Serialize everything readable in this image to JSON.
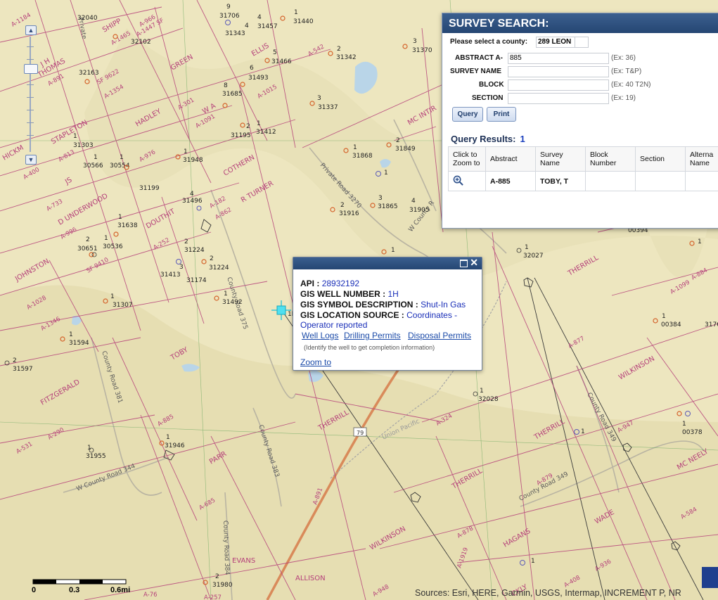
{
  "survey_panel": {
    "title": "SURVEY SEARCH:",
    "county_label": "Please select a county:",
    "county_value": "289 LEON",
    "fields": [
      {
        "label": "ABSTRACT A-",
        "value": "885",
        "example": "(Ex: 36)"
      },
      {
        "label": "SURVEY NAME",
        "value": "",
        "example": "(Ex: T&P)"
      },
      {
        "label": "BLOCK",
        "value": "",
        "example": "(Ex: 40 T2N)"
      },
      {
        "label": "SECTION",
        "value": "",
        "example": "(Ex: 19)"
      }
    ],
    "query_button": "Query",
    "print_button": "Print",
    "results_label": "Query Results:",
    "results_count": "1",
    "columns": [
      "Click to Zoom to",
      "Abstract",
      "Survey Name",
      "Block Number",
      "Section",
      "Alterna Name"
    ],
    "rows": [
      {
        "abstract": "A-885",
        "survey_name": "TOBY, T",
        "block": "",
        "section": "",
        "alt": ""
      }
    ]
  },
  "popup": {
    "api_label": "API :",
    "api_value": "28932192",
    "well_number_label": "GIS WELL NUMBER :",
    "well_number_value": "1H",
    "symbol_label": "GIS SYMBOL DESCRIPTION :",
    "symbol_value": "Shut-In Gas",
    "location_label": "GIS LOCATION SOURCE :",
    "location_value_1": "Coordinates -",
    "location_value_2": "Operator reported",
    "link_well_logs": "Well Logs",
    "link_drilling": "Drilling Permits",
    "link_disposal": "Disposal Permits",
    "note": "(Identify the well to get completion information)",
    "zoom_to": "Zoom to"
  },
  "scale": {
    "labels": [
      "0",
      "0.3",
      "0.6mi"
    ]
  },
  "attribution": "Sources: Esri, HERE, Garmin, USGS, Intermap, INCREMENT P, NR",
  "map_labels": {
    "surveys": [
      "J H THOMAS",
      "A STAPLETON",
      "HADLEY",
      "E GREEN",
      "W A",
      "JS",
      "D UNDERWOOD",
      "W DOUTHIT",
      "R TURNER",
      "A COTHERN",
      "JB JOHNSTON",
      "T TOBY",
      "J FITZGERALD",
      "J FITZGERALD",
      "S PARR",
      "W EVANS",
      "J ALLISON",
      "W H WILKINSON",
      "JB & JE THERRILL",
      "JB & JE THERRILL",
      "JB & JE THERRILL",
      "JB & JE THERRILL",
      "M HAGANS",
      "R WADE",
      "W H WILKINSON",
      "H MC NEELY",
      "W MC INTIR",
      "SHIPP",
      "HICKM",
      "ELLIS",
      "CKLY"
    ],
    "abstracts": [
      "A-1184",
      "A-966",
      "A-1447 SF",
      "A-1465",
      "A-891",
      "SF 9622",
      "A-1354",
      "A-301",
      "A-1091",
      "A-813",
      "A-976",
      "A-400",
      "A-733",
      "A-996",
      "A-252",
      "SF 9410",
      "A-182",
      "A-862",
      "A-1028",
      "A-1346",
      "A-542",
      "A-1015",
      "A-885",
      "A-290",
      "A-531",
      "A-685",
      "A-324",
      "A-877",
      "A-947",
      "A-879",
      "A-584",
      "A-878",
      "A-1919",
      "A-936",
      "A-408",
      "A-948",
      "A-76",
      "A-257",
      "A-1099",
      "A-884",
      "A-891"
    ],
    "roads": [
      "Private Road 3270",
      "County Road 375",
      "County Road 381",
      "County Road 383",
      "County Road 384",
      "County Road 349",
      "County Road 349",
      "W County Road 344",
      "W County R",
      "Union Pacific",
      "79",
      "Private"
    ],
    "wells": [
      "32040",
      "32102",
      "32163",
      "31706",
      "31343",
      "31457",
      "31440",
      "31466",
      "31493",
      "31685",
      "31337",
      "31342",
      "31370",
      "31195",
      "31412",
      "31303",
      "31948",
      "30566",
      "30554",
      "31199",
      "31496",
      "31868",
      "31849",
      "31865",
      "31905",
      "31916",
      "31638",
      "30651",
      "30536",
      "31224",
      "31224",
      "31413",
      "31174",
      "31307",
      "31492",
      "31594",
      "31597",
      "31955",
      "31946",
      "31980",
      "32027",
      "00384",
      "3176",
      "32028",
      "00378",
      "00394",
      "1",
      "2",
      "3",
      "4",
      "5",
      "6",
      "8",
      "9",
      "1H"
    ]
  },
  "colors": {
    "map_background": "#ede6bf",
    "survey_lines": "#b5407a",
    "well_symbols": "#d4622a",
    "panel_header": "#254673",
    "highway": "#d98a5a",
    "water": "#b9d5e8"
  }
}
